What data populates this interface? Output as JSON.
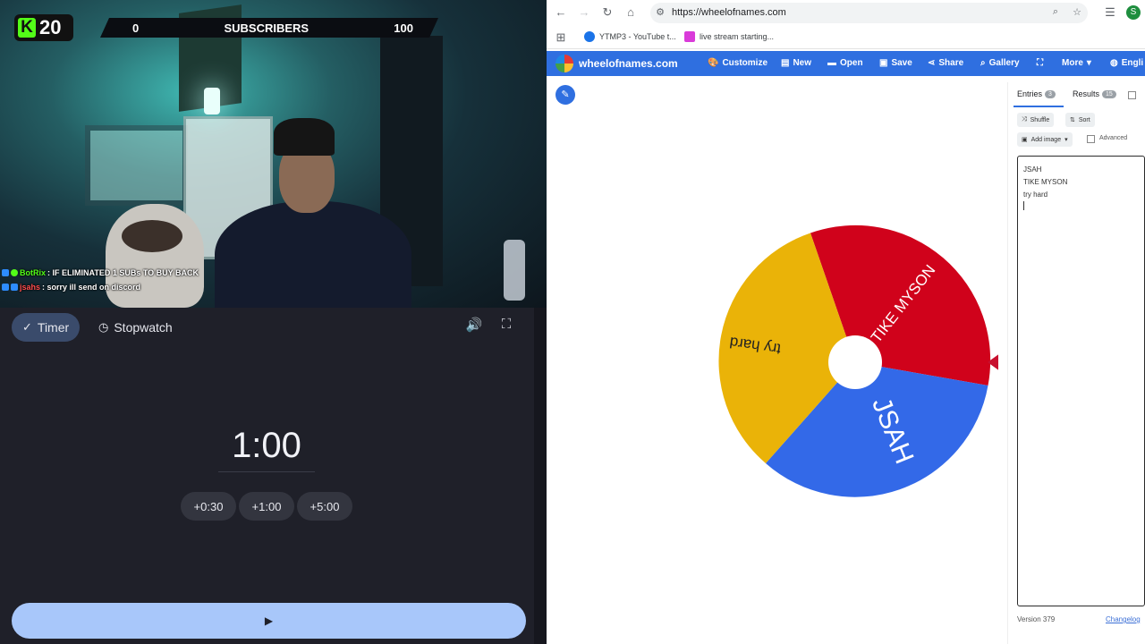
{
  "stream_overlay": {
    "kick_count": "20",
    "kick_logo_letter": "K",
    "sub_goal_current": "0",
    "sub_goal_label": "SUBSCRIBERS",
    "sub_goal_target": "100",
    "chat": [
      {
        "user": "BotRix",
        "message": ": IF ELIMINATED 1 SUBs TO BUY BACK"
      },
      {
        "user": "jsahs",
        "message": ": sorry ill send on discord"
      }
    ]
  },
  "timer": {
    "tabs": [
      {
        "label": "Timer",
        "icon": "check-icon"
      },
      {
        "label": "Stopwatch",
        "icon": "clock-icon"
      }
    ],
    "display": "1:00",
    "add_buttons": [
      "+0:30",
      "+1:00",
      "+5:00"
    ]
  },
  "browser": {
    "url": "https://wheelofnames.com",
    "bookmarks": [
      "YTMP3 - YouTube t...",
      "live stream starting..."
    ],
    "profile_initial": "S",
    "site_name": "wheelofnames.com",
    "menu": [
      "Customize",
      "New",
      "Open",
      "Save",
      "Share",
      "Gallery",
      "More",
      "Engli"
    ]
  },
  "wheel": {
    "segments": [
      {
        "label": "TIKE MYSON",
        "color": "#d0021b"
      },
      {
        "label": "JSAH",
        "color": "#3369e8"
      },
      {
        "label": "try hard",
        "color": "#eab308"
      }
    ]
  },
  "sidebar": {
    "tab_entries": "Entries",
    "entries_count": "3",
    "tab_results": "Results",
    "results_count": "15",
    "shuffle_label": "Shuffle",
    "sort_label": "Sort",
    "add_image_label": "Add image",
    "advanced_label": "Advanced",
    "entries": [
      "JSAH",
      "TIKE MYSON",
      "try hard"
    ],
    "version": "Version 379",
    "changelog": "Changelog"
  }
}
